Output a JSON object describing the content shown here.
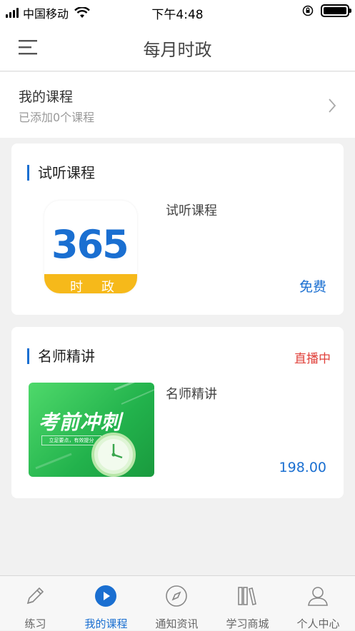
{
  "status_bar": {
    "carrier": "中国移动",
    "time": "下午4:48"
  },
  "navbar": {
    "title": "每月时政",
    "menu_icon": "menu-icon"
  },
  "my_course": {
    "title": "我的课程",
    "subtitle": "已添加0个课程",
    "arrow_icon": "chevron-right-icon"
  },
  "trial_section": {
    "title": "试听课程",
    "course": {
      "thumb_number": "365",
      "thumb_band_left": "时",
      "thumb_band_right": "政",
      "name": "试听课程",
      "price": "免费"
    }
  },
  "teacher_section": {
    "title": "名师精讲",
    "live_label": "直播中",
    "course": {
      "thumb_title": "考前冲刺",
      "thumb_sub": "立足要点，有效提分",
      "name": "名师精讲",
      "price": "198.00"
    }
  },
  "tabbar": {
    "items": [
      {
        "label": "练习",
        "icon": "pencil-icon",
        "active": false
      },
      {
        "label": "我的课程",
        "icon": "play-icon",
        "active": true
      },
      {
        "label": "通知资讯",
        "icon": "compass-icon",
        "active": false
      },
      {
        "label": "学习商城",
        "icon": "books-icon",
        "active": false
      },
      {
        "label": "个人中心",
        "icon": "person-icon",
        "active": false
      }
    ]
  },
  "colors": {
    "accent": "#1a6fd1",
    "live": "#e0413b",
    "thumb_yellow": "#f6b91a",
    "thumb_green": "#22b24c"
  }
}
